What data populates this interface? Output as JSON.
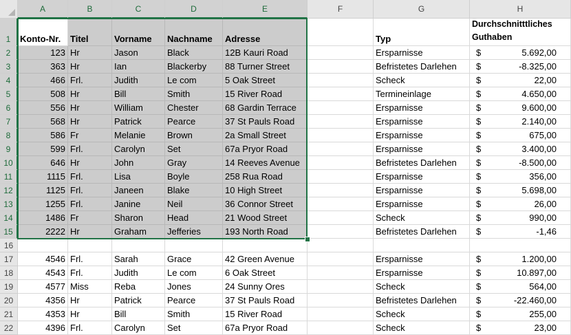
{
  "columns": [
    "A",
    "B",
    "C",
    "D",
    "E",
    "F",
    "G",
    "H"
  ],
  "headers": {
    "konto": "Konto-Nr.",
    "titel": "Titel",
    "vorname": "Vorname",
    "nachname": "Nachname",
    "adresse": "Adresse",
    "typ": "Typ",
    "guthaben_1": "Durchschnitttliches",
    "guthaben_2": "Guthaben"
  },
  "currency_symbol": "$",
  "rows": [
    {
      "num": "2",
      "konto": "123",
      "titel": "Hr",
      "vorname": "Jason",
      "nachname": "Black",
      "adresse": "12B Kauri Road",
      "typ": "Ersparnisse",
      "guthaben": "5.692,00"
    },
    {
      "num": "3",
      "konto": "363",
      "titel": "Hr",
      "vorname": "Ian",
      "nachname": "Blackerby",
      "adresse": "88 Turner Street",
      "typ": "Befristetes Darlehen",
      "guthaben": "-8.325,00"
    },
    {
      "num": "4",
      "konto": "466",
      "titel": "Frl.",
      "vorname": "Judith",
      "nachname": "Le com",
      "adresse": "5 Oak Street",
      "typ": "Scheck",
      "guthaben": "22,00"
    },
    {
      "num": "5",
      "konto": "508",
      "titel": "Hr",
      "vorname": "Bill",
      "nachname": "Smith",
      "adresse": "15 River Road",
      "typ": "Termineinlage",
      "guthaben": "4.650,00"
    },
    {
      "num": "6",
      "konto": "556",
      "titel": "Hr",
      "vorname": "William",
      "nachname": "Chester",
      "adresse": "68 Gardin Terrace",
      "typ": "Ersparnisse",
      "guthaben": "9.600,00"
    },
    {
      "num": "7",
      "konto": "568",
      "titel": "Hr",
      "vorname": "Patrick",
      "nachname": "Pearce",
      "adresse": "37 St Pauls Road",
      "typ": "Ersparnisse",
      "guthaben": "2.140,00"
    },
    {
      "num": "8",
      "konto": "586",
      "titel": "Fr",
      "vorname": "Melanie",
      "nachname": "Brown",
      "adresse": "2a Small Street",
      "typ": "Ersparnisse",
      "guthaben": "675,00"
    },
    {
      "num": "9",
      "konto": "599",
      "titel": "Frl.",
      "vorname": "Carolyn",
      "nachname": "Set",
      "adresse": "67a Pryor Road",
      "typ": "Ersparnisse",
      "guthaben": "3.400,00"
    },
    {
      "num": "10",
      "konto": "646",
      "titel": "Hr",
      "vorname": "John",
      "nachname": "Gray",
      "adresse": "14 Reeves Avenue",
      "typ": "Befristetes Darlehen",
      "guthaben": "-8.500,00"
    },
    {
      "num": "11",
      "konto": "1115",
      "titel": "Frl.",
      "vorname": "Lisa",
      "nachname": "Boyle",
      "adresse": "258 Rua Road",
      "typ": "Ersparnisse",
      "guthaben": "356,00"
    },
    {
      "num": "12",
      "konto": "1125",
      "titel": "Frl.",
      "vorname": "Janeen",
      "nachname": "Blake",
      "adresse": "10 High Street",
      "typ": "Ersparnisse",
      "guthaben": "5.698,00"
    },
    {
      "num": "13",
      "konto": "1255",
      "titel": "Frl.",
      "vorname": "Janine",
      "nachname": "Neil",
      "adresse": "36 Connor Street",
      "typ": "Ersparnisse",
      "guthaben": "26,00"
    },
    {
      "num": "14",
      "konto": "1486",
      "titel": "Fr",
      "vorname": "Sharon",
      "nachname": "Head",
      "adresse": "21 Wood Street",
      "typ": "Scheck",
      "guthaben": "990,00"
    },
    {
      "num": "15",
      "konto": "2222",
      "titel": "Hr",
      "vorname": "Graham",
      "nachname": "Jefferies",
      "adresse": "193 North Road",
      "typ": "Befristetes Darlehen",
      "guthaben": "-1,46"
    },
    {
      "num": "16",
      "konto": "",
      "titel": "",
      "vorname": "",
      "nachname": "",
      "adresse": "",
      "typ": "",
      "guthaben": ""
    },
    {
      "num": "17",
      "konto": "4546",
      "titel": "Frl.",
      "vorname": "Sarah",
      "nachname": "Grace",
      "adresse": "42 Green Avenue",
      "typ": "Ersparnisse",
      "guthaben": "1.200,00"
    },
    {
      "num": "18",
      "konto": "4543",
      "titel": "Frl.",
      "vorname": "Judith",
      "nachname": "Le com",
      "adresse": "6 Oak Street",
      "typ": "Ersparnisse",
      "guthaben": "10.897,00"
    },
    {
      "num": "19",
      "konto": "4577",
      "titel": "Miss",
      "vorname": "Reba",
      "nachname": "Jones",
      "adresse": "24 Sunny Ores",
      "typ": "Scheck",
      "guthaben": "564,00"
    },
    {
      "num": "20",
      "konto": "4356",
      "titel": "Hr",
      "vorname": "Patrick",
      "nachname": "Pearce",
      "adresse": "37 St Pauls Road",
      "typ": "Befristetes Darlehen",
      "guthaben": "-22.460,00"
    },
    {
      "num": "21",
      "konto": "4353",
      "titel": "Hr",
      "vorname": "Bill",
      "nachname": "Smith",
      "adresse": "15 River Road",
      "typ": "Scheck",
      "guthaben": "255,00"
    },
    {
      "num": "22",
      "konto": "4396",
      "titel": "Frl.",
      "vorname": "Carolyn",
      "nachname": "Set",
      "adresse": "67a Pryor Road",
      "typ": "Scheck",
      "guthaben": "23,00"
    }
  ],
  "selection": {
    "range": "A1:E15",
    "accent": "#217346",
    "fill": "#cccccc"
  }
}
